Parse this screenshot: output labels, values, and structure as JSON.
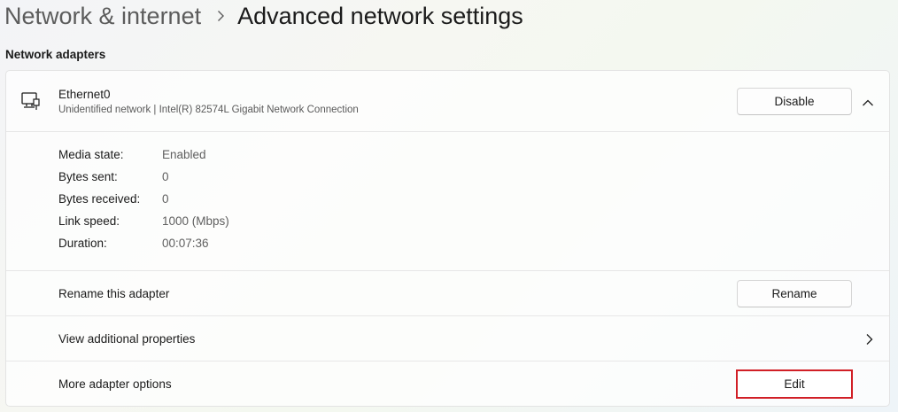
{
  "breadcrumb": {
    "parent": "Network & internet",
    "current": "Advanced network settings"
  },
  "section": {
    "title": "Network adapters"
  },
  "adapter": {
    "name": "Ethernet0",
    "description": "Unidentified network | Intel(R) 82574L Gigabit Network Connection",
    "icon": "ethernet-adapter-icon",
    "disable_label": "Disable",
    "expanded": true,
    "details": [
      {
        "label": "Media state:",
        "value": "Enabled"
      },
      {
        "label": "Bytes sent:",
        "value": "0"
      },
      {
        "label": "Bytes received:",
        "value": "0"
      },
      {
        "label": "Link speed:",
        "value": "1000 (Mbps)"
      },
      {
        "label": "Duration:",
        "value": "00:07:36"
      }
    ],
    "rename": {
      "label": "Rename this adapter",
      "button": "Rename"
    },
    "properties": {
      "label": "View additional properties"
    },
    "more_options": {
      "label": "More adapter options",
      "button": "Edit"
    }
  },
  "colors": {
    "highlight": "#d11f26",
    "text_primary": "#1b1b1b",
    "text_secondary": "#5f5f5f"
  }
}
